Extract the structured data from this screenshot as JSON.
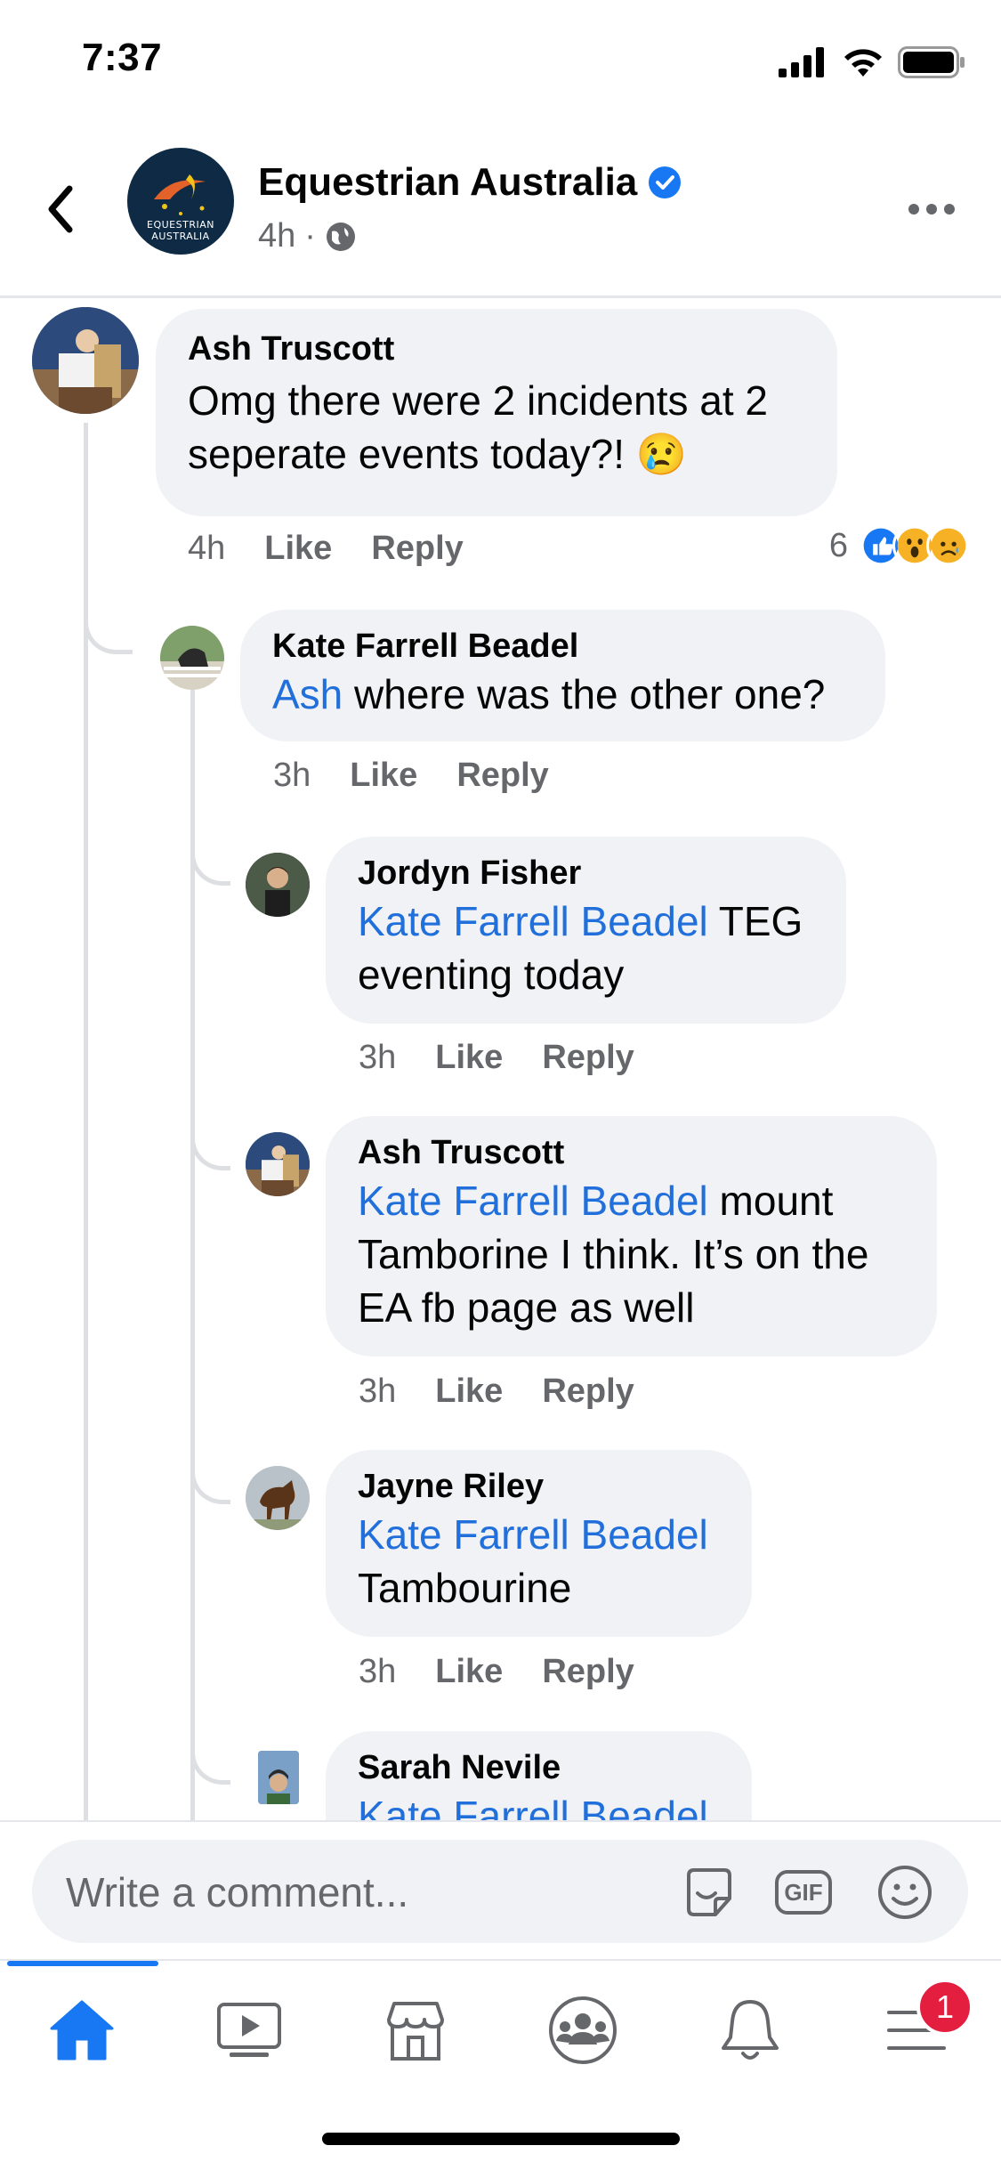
{
  "status_bar": {
    "time": "7:37"
  },
  "header": {
    "page_name": "Equestrian Australia",
    "avatar_line1": "EQUESTRIAN",
    "avatar_line2": "AUSTRALIA",
    "time": "4h",
    "separator": "·",
    "visibility_icon": "globe-icon"
  },
  "comments": [
    {
      "author": "Ash Truscott",
      "mention": "",
      "text": "Omg there were 2 incidents at 2 seperate events today?! 😢",
      "time": "4h",
      "like": "Like",
      "reply": "Reply",
      "reaction_count": "6",
      "reactions": [
        "like",
        "wow",
        "sad"
      ]
    },
    {
      "author": "Kate Farrell Beadel",
      "mention": "Ash",
      "text": " where was the other one?",
      "time": "3h",
      "like": "Like",
      "reply": "Reply"
    },
    {
      "author": "Jordyn Fisher",
      "mention": "Kate Farrell Beadel",
      "text": " TEG eventing today",
      "time": "3h",
      "like": "Like",
      "reply": "Reply"
    },
    {
      "author": "Ash Truscott",
      "mention": "Kate Farrell Beadel",
      "text": " mount Tamborine I think. It’s on the EA fb page as well",
      "time": "3h",
      "like": "Like",
      "reply": "Reply"
    },
    {
      "author": "Jayne Riley",
      "mention": "Kate Farrell Beadel",
      "text": " Tambourine",
      "time": "3h",
      "like": "Like",
      "reply": "Reply"
    },
    {
      "author": "Sarah Nevile",
      "mention": "Kate Farrell Beadel",
      "text": ""
    }
  ],
  "composer": {
    "placeholder": "Write a comment...",
    "gif_label": "GIF"
  },
  "tabbar": {
    "tabs": [
      "home-icon",
      "watch-icon",
      "marketplace-icon",
      "groups-icon",
      "notifications-icon",
      "menu-icon"
    ],
    "menu_badge": "1",
    "accent": "#1877f2"
  }
}
